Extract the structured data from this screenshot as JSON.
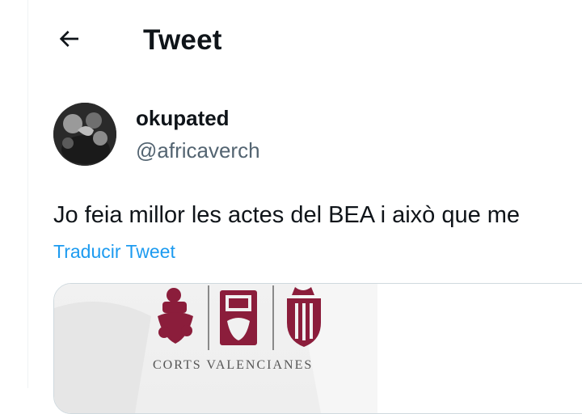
{
  "header": {
    "title": "Tweet",
    "back_icon": "arrow-left-icon"
  },
  "author": {
    "display_name": "okupated",
    "handle": "@africaverch"
  },
  "tweet": {
    "text": "Jo feia millor les actes del BEA i això que me",
    "translate_label": "Traducir Tweet"
  },
  "media": {
    "logo_caption": "CORTS VALENCIANES",
    "logo_color": "#8b1d3b"
  },
  "colors": {
    "link": "#1d9bf0",
    "secondary_text": "#536471",
    "border": "#cfd9de"
  }
}
